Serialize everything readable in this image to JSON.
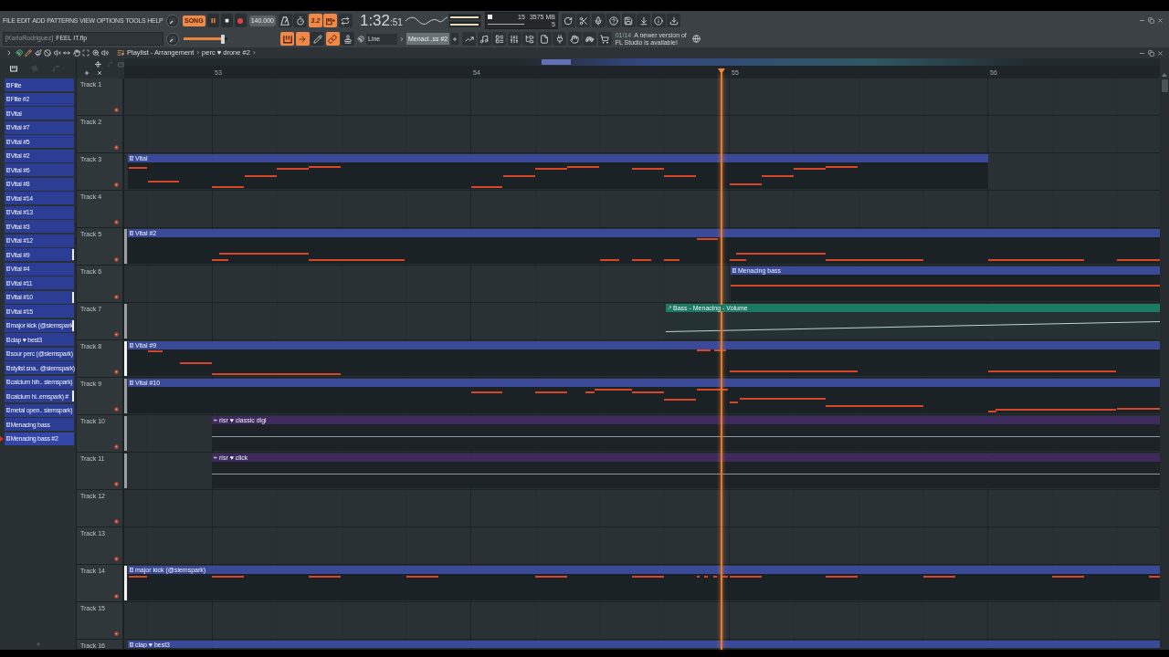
{
  "menu": [
    "FILE",
    "EDIT",
    "ADD",
    "PATTERNS",
    "VIEW",
    "OPTIONS",
    "TOOLS",
    "HELP"
  ],
  "transport": {
    "mode_label": "SONG",
    "song_mode": true,
    "playing": true,
    "tempo": "140.000",
    "time": "1:32",
    "time_small": ":51"
  },
  "toggles_row_1": [
    {
      "kind": "metronome",
      "on": false
    },
    {
      "kind": "wait",
      "on": false
    },
    {
      "kind": "countdown",
      "label": "3.2",
      "on": true
    },
    {
      "kind": "step-record",
      "on": true
    },
    {
      "kind": "loop-record",
      "on": false
    }
  ],
  "output_meter": [
    {
      "level": 0.97
    },
    {
      "level": 0.97
    }
  ],
  "resources": {
    "cpu": "15",
    "memory": "3575 MB",
    "polyphony": "5"
  },
  "project": {
    "user": "[KarloRodriguez]",
    "file": "FEEL IT.flp"
  },
  "master_pitch": {
    "level": 0.9
  },
  "toggles_row_2": [
    {
      "kind": "typing-keyboard",
      "on": true
    },
    {
      "kind": "step-edit",
      "on": true
    },
    {
      "kind": "pencil",
      "on": false
    },
    {
      "kind": "link",
      "on": true
    },
    {
      "kind": "stamp",
      "on": false
    }
  ],
  "snap": {
    "value": "Line"
  },
  "pattern_selector": {
    "value": "Menaci..ss #2"
  },
  "news": {
    "date": "01/14",
    "lines": [
      "A newer version of",
      "FL Studio is available!"
    ]
  },
  "playlist": {
    "breadcrumb": [
      {
        "kind": "title",
        "text": "Playlist - Arrangement"
      },
      {
        "kind": "separator",
        "text": "›"
      },
      {
        "kind": "crumb",
        "text": "perc ♥ drone #2"
      },
      {
        "kind": "separator",
        "text": "›"
      }
    ],
    "ruler": [
      "53",
      "54",
      "55",
      "56"
    ],
    "picker": [
      {
        "name": "Flite",
        "selected": false,
        "flagged": false
      },
      {
        "name": "Flite #2",
        "selected": false,
        "flagged": false
      },
      {
        "name": "Vital",
        "selected": false,
        "flagged": false
      },
      {
        "name": "Vital #7",
        "selected": false,
        "flagged": false
      },
      {
        "name": "Vital #5",
        "selected": false,
        "flagged": false
      },
      {
        "name": "Vital #2",
        "selected": false,
        "flagged": false
      },
      {
        "name": "Vital #6",
        "selected": false,
        "flagged": false
      },
      {
        "name": "Vital #8",
        "selected": false,
        "flagged": false
      },
      {
        "name": "Vital #14",
        "selected": false,
        "flagged": false
      },
      {
        "name": "Vital #13",
        "selected": false,
        "flagged": false
      },
      {
        "name": "Vital #3",
        "selected": false,
        "flagged": false
      },
      {
        "name": "Vital #12",
        "selected": false,
        "flagged": false
      },
      {
        "name": "Vital #9",
        "selected": false,
        "flagged": true
      },
      {
        "name": "Vital #4",
        "selected": false,
        "flagged": false
      },
      {
        "name": "Vital #11",
        "selected": false,
        "flagged": false
      },
      {
        "name": "Vital #10",
        "selected": false,
        "flagged": true
      },
      {
        "name": "Vital #15",
        "selected": false,
        "flagged": false
      },
      {
        "name": "major kick (@siemspark",
        "selected": false,
        "flagged": true
      },
      {
        "name": "clap ♥ best3",
        "selected": false,
        "flagged": false
      },
      {
        "name": "sour perc (@siemspark)",
        "selected": false,
        "flagged": false
      },
      {
        "name": "stylist sna.. @siemspark)",
        "selected": false,
        "flagged": false
      },
      {
        "name": "calcium hih.. siemspark)",
        "selected": false,
        "flagged": false
      },
      {
        "name": "calcium hi..emspark) #",
        "selected": false,
        "flagged": true
      },
      {
        "name": "metal open.. siemspark)",
        "selected": false,
        "flagged": false
      },
      {
        "name": "Menacing bass",
        "selected": false,
        "flagged": false
      },
      {
        "name": "Menacing bass #2",
        "selected": true,
        "flagged": false
      }
    ],
    "tracks": [
      {
        "name": "Track 1"
      },
      {
        "name": "Track 2"
      },
      {
        "name": "Track 3",
        "clips": [
          {
            "kind": "pattern",
            "label": "Vital"
          }
        ]
      },
      {
        "name": "Track 4"
      },
      {
        "name": "Track 5",
        "clips": [
          {
            "kind": "pattern",
            "label": "Vital #2"
          }
        ]
      },
      {
        "name": "Track 6",
        "clips": [
          {
            "kind": "pattern",
            "label": "Menacing bass"
          }
        ]
      },
      {
        "name": "Track 7",
        "clips": [
          {
            "kind": "automation",
            "label": "Bass - Menacing - Volume"
          }
        ]
      },
      {
        "name": "Track 8",
        "clips": [
          {
            "kind": "pattern",
            "label": "Vital #9"
          }
        ]
      },
      {
        "name": "Track 9",
        "clips": [
          {
            "kind": "pattern",
            "label": "Vital #10"
          }
        ]
      },
      {
        "name": "Track 10",
        "clips": [
          {
            "kind": "audio",
            "label": "risr ♥ classic digi"
          }
        ]
      },
      {
        "name": "Track 11",
        "clips": [
          {
            "kind": "audio",
            "label": "risr ♥ click"
          }
        ]
      },
      {
        "name": "Track 12"
      },
      {
        "name": "Track 13"
      },
      {
        "name": "Track 14",
        "clips": [
          {
            "kind": "pattern",
            "label": "major kick (@siemspark)"
          }
        ]
      },
      {
        "name": "Track 15"
      },
      {
        "name": "Track 16",
        "clips": [
          {
            "kind": "pattern",
            "label": "clap ♥ best3"
          }
        ]
      }
    ]
  }
}
